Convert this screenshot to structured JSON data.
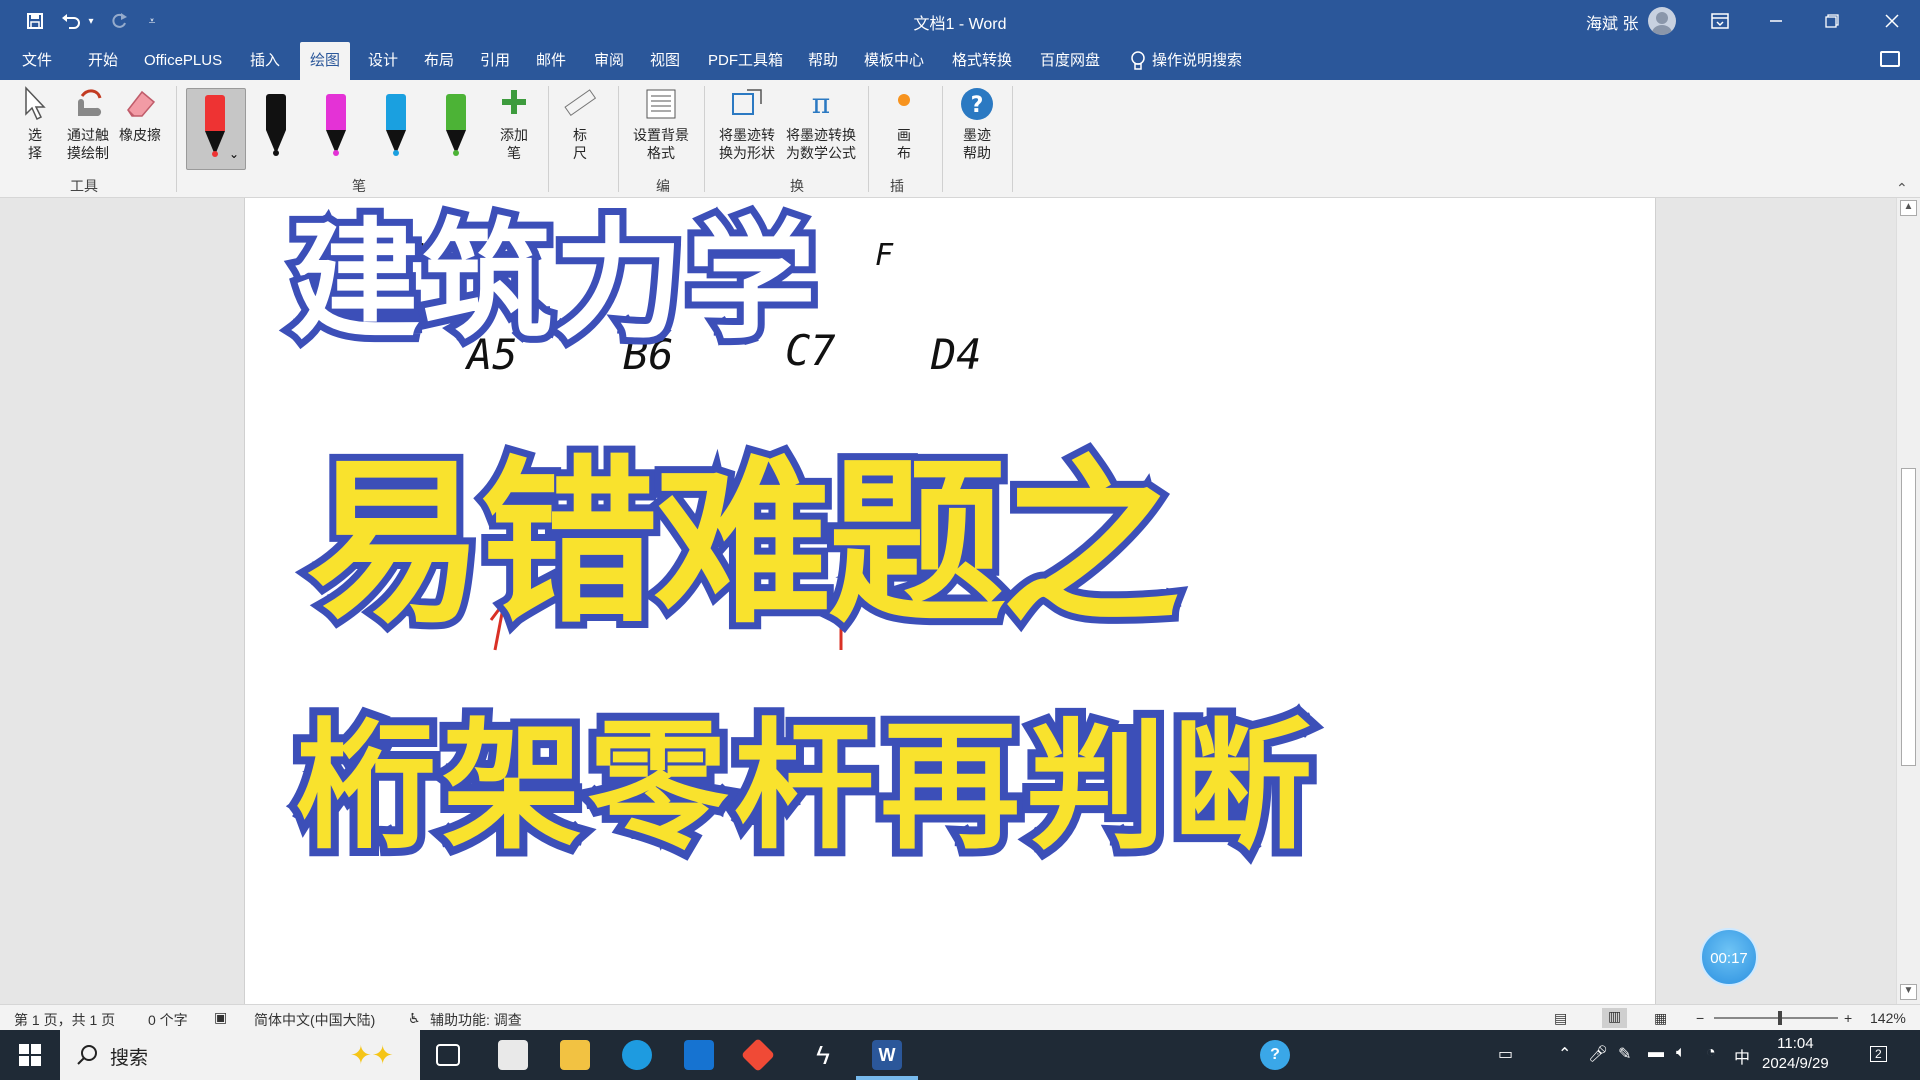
{
  "titlebar": {
    "title": "文档1  -  Word",
    "user_name": "海斌 张",
    "qa_more": "⩡"
  },
  "tabs": [
    {
      "label": "文件"
    },
    {
      "label": "开始"
    },
    {
      "label": "OfficePLUS"
    },
    {
      "label": "插入"
    },
    {
      "label": "绘图"
    },
    {
      "label": "设计"
    },
    {
      "label": "布局"
    },
    {
      "label": "引用"
    },
    {
      "label": "邮件"
    },
    {
      "label": "审阅"
    },
    {
      "label": "视图"
    },
    {
      "label": "PDF工具箱"
    },
    {
      "label": "帮助"
    },
    {
      "label": "模板中心"
    },
    {
      "label": "格式转换"
    },
    {
      "label": "百度网盘"
    }
  ],
  "tell_me": "操作说明搜索",
  "ribbon": {
    "select": "选\n择",
    "touch_draw": "通过触\n摸绘制",
    "eraser": "橡皮擦",
    "tools_group": "工具",
    "add_pen": "添加\n笔",
    "ruler": "标\n尺",
    "bg_format": "设置背景\n格式",
    "ink_to_shape": "将墨迹转\n换为形状",
    "ink_to_math": "将墨迹转换\n为数学公式",
    "canvas": "画\n布",
    "ink_help": "墨迹\n帮助",
    "group_frag_1": "笔",
    "group_frag_2": "编",
    "group_frag_3": "换",
    "group_frag_4": "插"
  },
  "handwriting": {
    "a": "A5",
    "b": "B6",
    "c": "C7",
    "d": "D4",
    "f1": "F",
    "f2": "F",
    "f3": "F"
  },
  "headline": {
    "line1": "建筑力学",
    "line2": "易错难题之",
    "line3": "桁架零杆再判断"
  },
  "timer": "00:17",
  "status": {
    "page": "第 1 页，共 1 页",
    "words": "0 个字",
    "lang": "简体中文(中国大陆)",
    "accessibility": "辅助功能: 调查",
    "zoom": "142%"
  },
  "taskbar": {
    "search": "搜索",
    "time": "11:04",
    "date": "2024/9/29",
    "ime": "中",
    "notif": "2"
  },
  "colors": {
    "accent": "#2b579a",
    "headline_stroke": "#3c4fb8",
    "headline_yellow": "#f9e22d"
  }
}
